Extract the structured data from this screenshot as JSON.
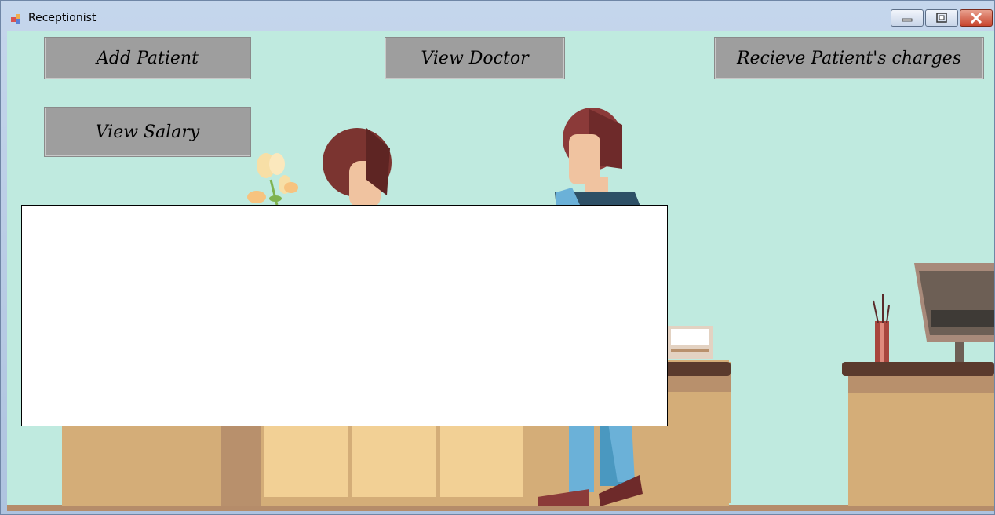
{
  "window": {
    "title": "Receptionist",
    "controls": {
      "minimize": "minimize",
      "maximize": "maximize",
      "close": "close"
    }
  },
  "buttons": {
    "add_patient": "Add Patient",
    "view_doctor": "View Doctor",
    "receive_charges": "Recieve Patient's charges",
    "view_salary": "View Salary"
  },
  "colors": {
    "background": "#bfeadf",
    "button": "#9e9e9e",
    "desk": "#d4ad78",
    "desk_top": "#5a3a2d"
  },
  "icons": [
    "app-icon",
    "minimize-icon",
    "maximize-icon",
    "close-icon"
  ]
}
